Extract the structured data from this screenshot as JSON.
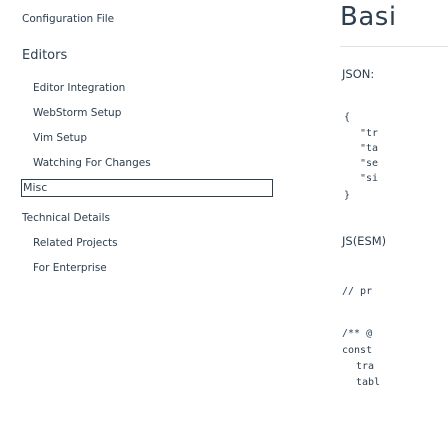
{
  "sidebar": {
    "top_link": "Configuration File",
    "section_title": "Editors",
    "editor_items": [
      "Editor Integration",
      "WebStorm Setup",
      "Vim Setup",
      "Watching For Changes"
    ],
    "misc_label": "Misc",
    "misc_items": [
      "Technical Details",
      "Related Projects",
      "For Enterprise"
    ]
  },
  "main": {
    "title": "Basi",
    "json_label": "JSON:",
    "json_code": {
      "open_brace": "{",
      "lines": [
        "\"tr",
        "\"ta",
        "\"se",
        "\"si"
      ],
      "close_brace": "}"
    },
    "js_label": "JS(ESM)",
    "js_code": {
      "comment1": "// pr",
      "comment2": "/** @",
      "decl": "const",
      "lines": [
        "tra",
        "tabl"
      ]
    }
  }
}
